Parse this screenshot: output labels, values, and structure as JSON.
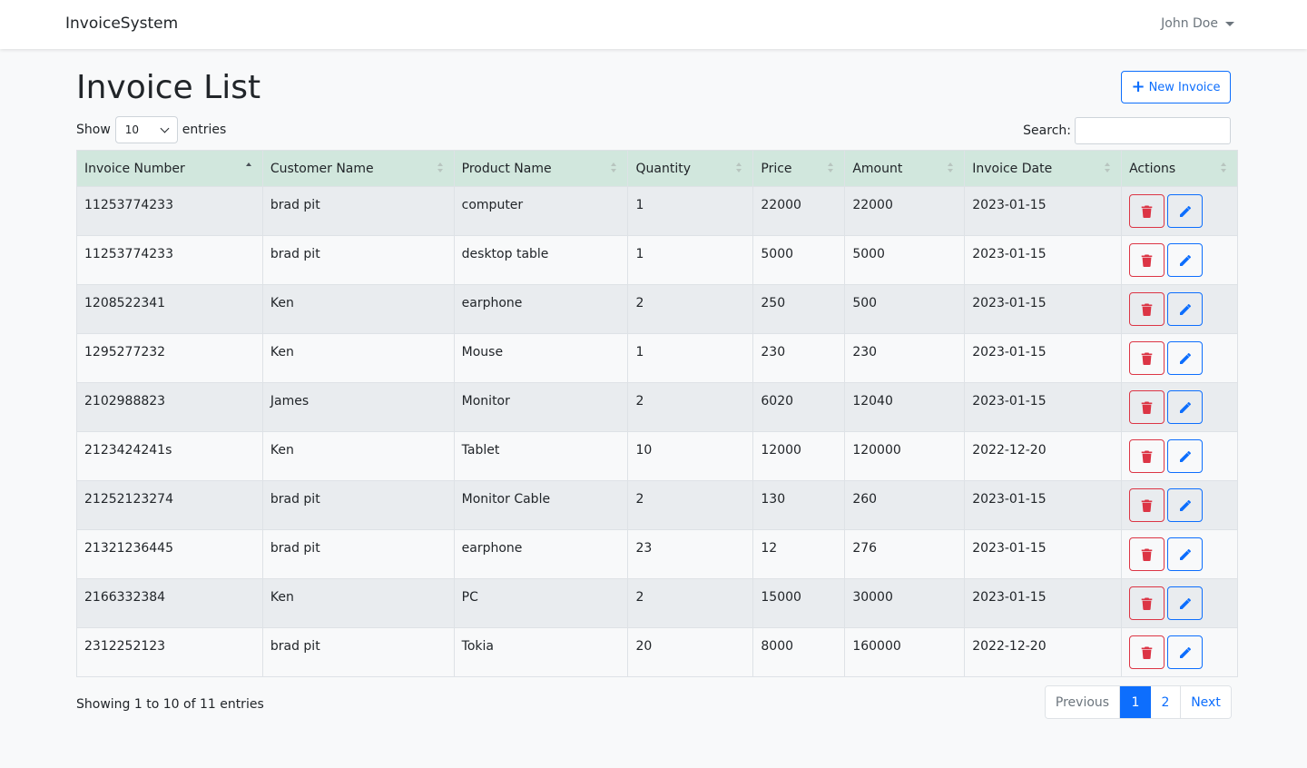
{
  "navbar": {
    "brand": "InvoiceSystem",
    "user": "John Doe"
  },
  "page": {
    "title": "Invoice List",
    "new_button": "New Invoice"
  },
  "length": {
    "show": "Show",
    "value": "10",
    "entries": "entries"
  },
  "search": {
    "label": "Search:",
    "value": ""
  },
  "table": {
    "headers": [
      "Invoice Number",
      "Customer Name",
      "Product Name",
      "Quantity",
      "Price",
      "Amount",
      "Invoice Date",
      "Actions"
    ],
    "sorted_column": "Invoice Number",
    "rows": [
      [
        "11253774233",
        "brad pit",
        "computer",
        "1",
        "22000",
        "22000",
        "2023-01-15"
      ],
      [
        "11253774233",
        "brad pit",
        "desktop table",
        "1",
        "5000",
        "5000",
        "2023-01-15"
      ],
      [
        "1208522341",
        "Ken",
        "earphone",
        "2",
        "250",
        "500",
        "2023-01-15"
      ],
      [
        "1295277232",
        "Ken",
        "Mouse",
        "1",
        "230",
        "230",
        "2023-01-15"
      ],
      [
        "2102988823",
        "James",
        "Monitor",
        "2",
        "6020",
        "12040",
        "2023-01-15"
      ],
      [
        "2123424241s",
        "Ken",
        "Tablet",
        "10",
        "12000",
        "120000",
        "2022-12-20"
      ],
      [
        "21252123274",
        "brad pit",
        "Monitor Cable",
        "2",
        "130",
        "260",
        "2023-01-15"
      ],
      [
        "21321236445",
        "brad pit",
        "earphone",
        "23",
        "12",
        "276",
        "2023-01-15"
      ],
      [
        "2166332384",
        "Ken",
        "PC",
        "2",
        "15000",
        "30000",
        "2023-01-15"
      ],
      [
        "2312252123",
        "brad pit",
        "Tokia",
        "20",
        "8000",
        "160000",
        "2022-12-20"
      ]
    ],
    "action_icons": [
      "trash-icon",
      "pencil-icon"
    ]
  },
  "footer": {
    "info": "Showing 1 to 10 of 11 entries",
    "pagination": {
      "previous": "Previous",
      "pages": [
        "1",
        "2"
      ],
      "current": "1",
      "next": "Next"
    }
  },
  "colors": {
    "primary": "#0d6efd",
    "danger": "#dc3545",
    "header_bg": "#d1e7dd",
    "stripe": "#e9ecef"
  }
}
